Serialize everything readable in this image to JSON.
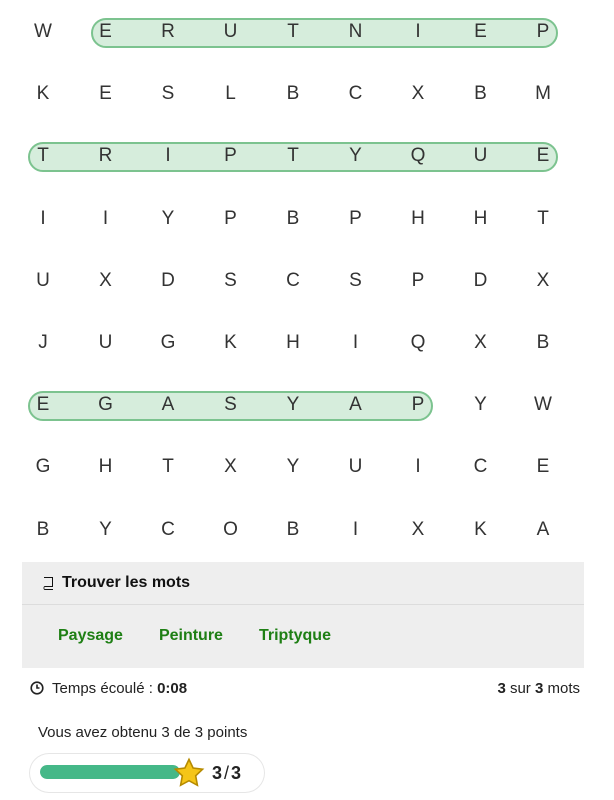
{
  "grid": [
    [
      "W",
      "E",
      "R",
      "U",
      "T",
      "N",
      "I",
      "E",
      "P"
    ],
    [
      "K",
      "E",
      "S",
      "L",
      "B",
      "C",
      "X",
      "B",
      "M"
    ],
    [
      "T",
      "R",
      "I",
      "P",
      "T",
      "Y",
      "Q",
      "U",
      "E"
    ],
    [
      "I",
      "I",
      "Y",
      "P",
      "B",
      "P",
      "H",
      "H",
      "T"
    ],
    [
      "U",
      "X",
      "D",
      "S",
      "C",
      "S",
      "P",
      "D",
      "X"
    ],
    [
      "J",
      "U",
      "G",
      "K",
      "H",
      "I",
      "Q",
      "X",
      "B"
    ],
    [
      "E",
      "G",
      "A",
      "S",
      "Y",
      "A",
      "P",
      "Y",
      "W"
    ],
    [
      "G",
      "H",
      "T",
      "X",
      "Y",
      "U",
      "I",
      "C",
      "E"
    ],
    [
      "B",
      "Y",
      "C",
      "O",
      "B",
      "I",
      "X",
      "K",
      "A"
    ]
  ],
  "found_highlights": [
    {
      "word": "Peinture",
      "row": 0,
      "from_col": 1,
      "to_col": 8
    },
    {
      "word": "Triptyque",
      "row": 2,
      "from_col": 0,
      "to_col": 8
    },
    {
      "word": "Paysage",
      "row": 6,
      "from_col": 0,
      "to_col": 6
    }
  ],
  "panel": {
    "title": "Trouver les mots",
    "words": [
      "Paysage",
      "Peinture",
      "Triptyque"
    ]
  },
  "status": {
    "elapsed_label": "Temps écoulé :",
    "elapsed_value": "0:08",
    "found_count": "3",
    "found_sep": "sur",
    "total_count": "3",
    "found_suffix": "mots"
  },
  "score": {
    "text": "Vous avez obtenu 3 de 3 points",
    "value": "3",
    "total": "3",
    "fraction": 1.0
  },
  "colors": {
    "word": "#1e7f14",
    "highlight_fill": "#d6eddc",
    "highlight_border": "#7cc38f",
    "progress": "#45b888",
    "star": "#f5c518"
  },
  "icons": {
    "panel": "book-icon",
    "status": "clock-icon",
    "progress": "star-icon"
  }
}
